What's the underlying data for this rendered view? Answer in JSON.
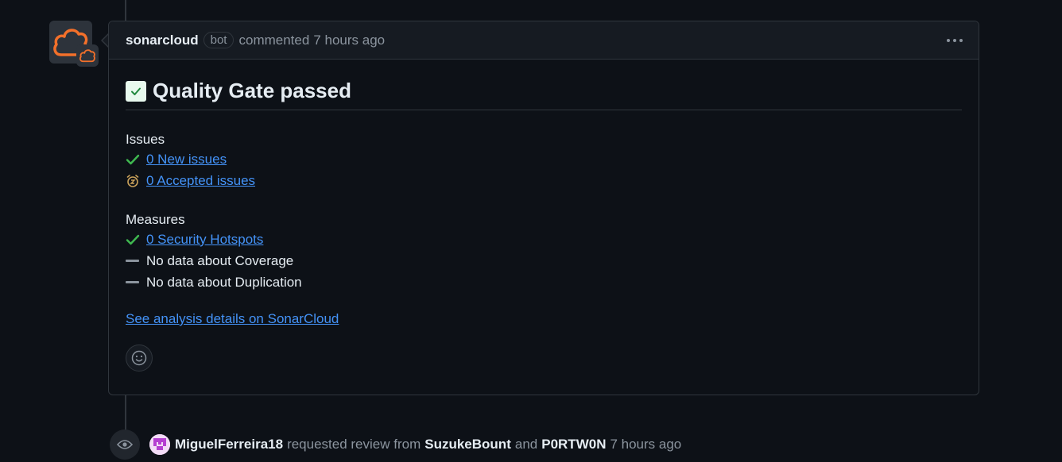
{
  "comment": {
    "author": "sonarcloud",
    "bot_label": "bot",
    "action": "commented",
    "timestamp": "7 hours ago",
    "title": "Quality Gate passed",
    "issues": {
      "heading": "Issues",
      "items": [
        {
          "icon": "check-icon",
          "text": "0 New issues",
          "link": true
        },
        {
          "icon": "alarm-clock-icon",
          "text": "0 Accepted issues",
          "link": true
        }
      ]
    },
    "measures": {
      "heading": "Measures",
      "items": [
        {
          "icon": "check-icon",
          "text": "0 Security Hotspots",
          "link": true
        },
        {
          "icon": "dash-icon",
          "text": "No data about Coverage",
          "link": false
        },
        {
          "icon": "dash-icon",
          "text": "No data about Duplication",
          "link": false
        }
      ]
    },
    "details_link": "See analysis details on SonarCloud"
  },
  "event": {
    "icon": "eye-icon",
    "actor": "MiguelFerreira18",
    "action": "requested review from",
    "reviewer1": "SuzukeBount",
    "conjunction": "and",
    "reviewer2": "P0RTW0N",
    "timestamp": "7 hours ago"
  },
  "colors": {
    "background": "#0d1117",
    "link": "#4493f8",
    "success": "#3fb950",
    "sonar_orange": "#f3702a",
    "border": "#30363d"
  }
}
